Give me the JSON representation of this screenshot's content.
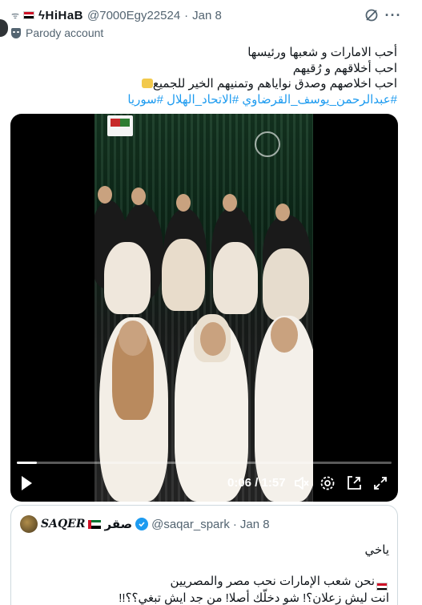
{
  "author": {
    "display_name": "ϟHiHaB",
    "handle": "@7000Egy22524",
    "separator": "·",
    "date": "Jan 8",
    "badge": "Parody account",
    "prefix_glyph": "ᯤ"
  },
  "body": {
    "line1": "أحب الامارات و شعبها ورئيسها",
    "line2": "احب أخلاقهم و رُقيهم",
    "line3": "احب اخلاصهم وصدق نواياهم وتمنيهم الخير للجميع",
    "hashtags": "#عبدالرحمن_يوسف_القرضاوي #الاتحاد_الهلال #سوريا"
  },
  "video": {
    "time_display": "0:06 / 1:57",
    "progress": 0.053,
    "icons": [
      "play-icon",
      "volume-muted-icon",
      "settings-icon",
      "pip-icon",
      "fullscreen-icon"
    ]
  },
  "quote": {
    "name_latin": "SAQER",
    "name_arabic": "صقر",
    "handle": "@saqar_spark",
    "separator": "·",
    "date": "Jan 8",
    "line1": "ياخي",
    "line2": "نحن شعب الإمارات  نحب مصر والمصريين",
    "line3": "انت ليش زعلان؟! شو دخلّك أصلا! من جد ايش تبغي؟؟!!"
  },
  "colors": {
    "text": "#0f1419",
    "muted": "#536471",
    "link": "#1d9bf0",
    "border": "#cfd9de"
  }
}
